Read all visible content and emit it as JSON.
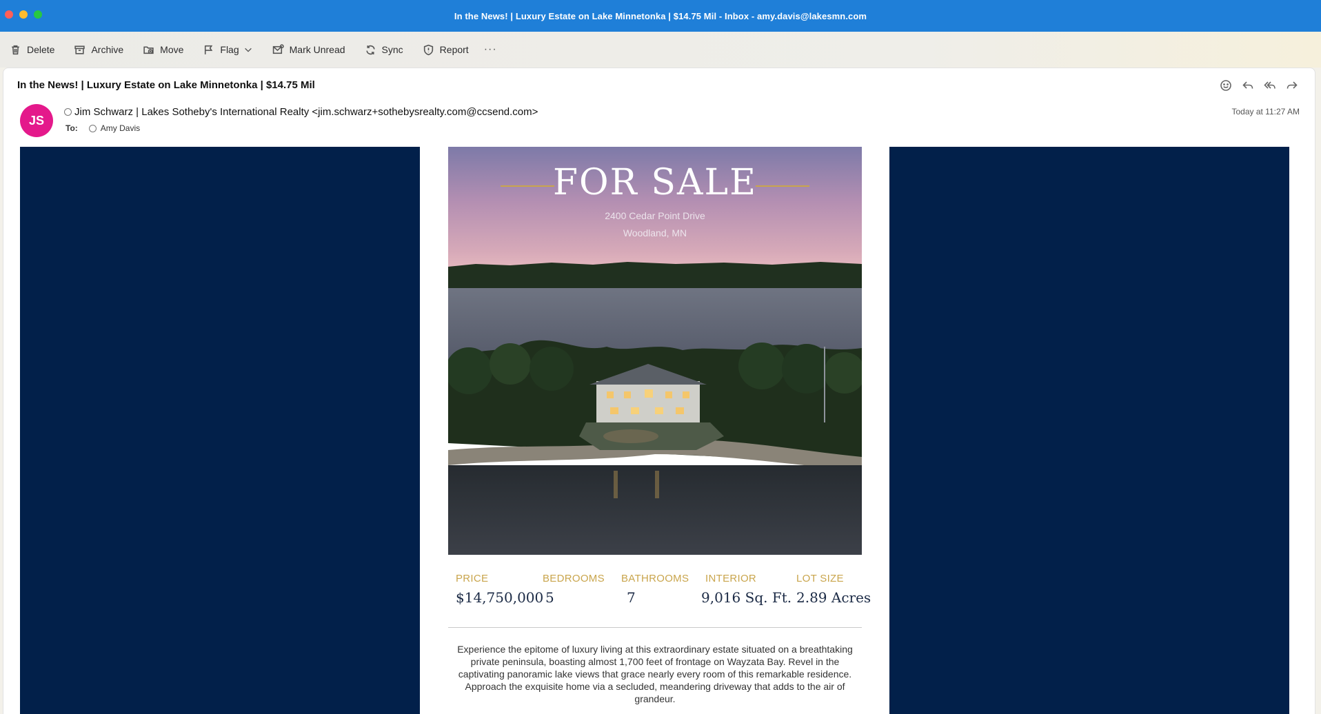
{
  "window": {
    "title": "In the News! | Luxury Estate on Lake Minnetonka | $14.75 Mil - Inbox - amy.davis@lakesmn.com"
  },
  "toolbar": {
    "delete": "Delete",
    "archive": "Archive",
    "move": "Move",
    "flag": "Flag",
    "mark_unread": "Mark Unread",
    "sync": "Sync",
    "report": "Report",
    "more": "···"
  },
  "message": {
    "subject": "In the News! | Luxury Estate on Lake Minnetonka | $14.75 Mil",
    "avatar_initials": "JS",
    "avatar_color": "#e4198b",
    "sender": "Jim Schwarz | Lakes Sotheby's International Realty <jim.schwarz+sothebysrealty.com@ccsend.com>",
    "to_label": "To:",
    "to_name": "Amy Davis",
    "timestamp": "Today at 11:27 AM",
    "actions": [
      "smiley-icon",
      "reply-icon",
      "reply-all-icon",
      "forward-icon"
    ]
  },
  "email": {
    "hero": {
      "title": "FOR SALE",
      "address": "2400 Cedar Point Drive",
      "city": "Woodland, MN"
    },
    "stats": [
      {
        "label": "PRICE",
        "value": "$14,750,000"
      },
      {
        "label": "BEDROOMS",
        "value": "5"
      },
      {
        "label": "BATHROOMS",
        "value": "7"
      },
      {
        "label": "INTERIOR",
        "value": "9,016 Sq. Ft."
      },
      {
        "label": "LOT SIZE",
        "value": "2.89 Acres"
      }
    ],
    "description": "Experience the epitome of luxury living at this extraordinary estate situated on a breathtaking private peninsula, boasting almost 1,700 feet of frontage on Wayzata Bay. Revel in the captivating panoramic lake views that grace nearly every room of this remarkable residence. Approach the exquisite home via a secluded, meandering driveway that adds to the air of grandeur.",
    "colors": {
      "navy": "#02204a",
      "gold": "#c9a54c"
    }
  }
}
